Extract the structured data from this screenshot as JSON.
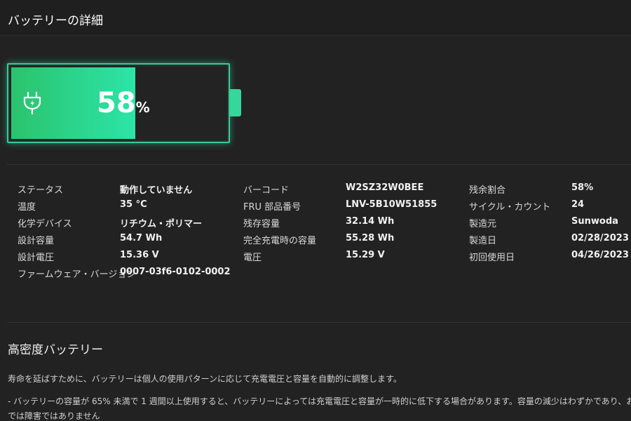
{
  "window": {
    "title": "バッテリーの詳細"
  },
  "battery": {
    "percent_value": "58",
    "percent_symbol": "%",
    "level": 0.58,
    "fill_color": "#2ce4a8"
  },
  "details": {
    "col1": [
      {
        "label": "ステータス",
        "value": "動作していません"
      },
      {
        "label": "温度",
        "value": "35 °C"
      },
      {
        "label": "化学デバイス",
        "value": "リチウム・ポリマー"
      },
      {
        "label": "設計容量",
        "value": "54.7 Wh"
      },
      {
        "label": "設計電圧",
        "value": "15.36 V"
      },
      {
        "label": "ファームウェア・バージョン",
        "value": "0007-03f6-0102-0002"
      }
    ],
    "col2": [
      {
        "label": "バーコード",
        "value": "W2SZ32W0BEE"
      },
      {
        "label": "FRU 部品番号",
        "value": "LNV-5B10W51855"
      },
      {
        "label": "残存容量",
        "value": "32.14 Wh"
      },
      {
        "label": "完全充電時の容量",
        "value": "55.28 Wh"
      },
      {
        "label": "電圧",
        "value": "15.29 V"
      }
    ],
    "col3": [
      {
        "label": "残余割合",
        "value": "58%"
      },
      {
        "label": "サイクル・カウント",
        "value": "24"
      },
      {
        "label": "製造元",
        "value": "Sunwoda"
      },
      {
        "label": "製造日",
        "value": "02/28/2023"
      },
      {
        "label": "初回使用日",
        "value": "04/26/2023"
      }
    ]
  },
  "high_density": {
    "title": "高密度バッテリー",
    "para1": "寿命を延ばすために、バッテリーは個人の使用パターンに応じて充電電圧と容量を自動的に調整します。",
    "para2": "- バッテリーの容量が 65% 未満で 1 週間以上使用すると、バッテリーによっては充電電圧と容量が一時的に低下する場合があります。容量の減少はわずかであり、お客様の",
    "para3": "では障害ではありません"
  }
}
